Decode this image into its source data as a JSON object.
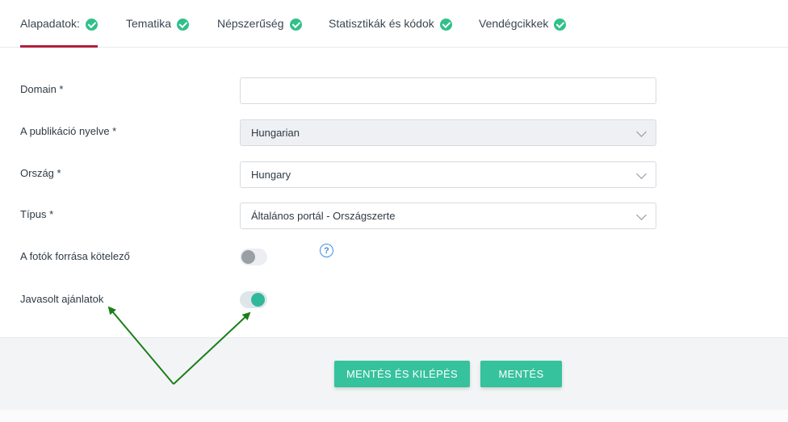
{
  "tabs": [
    {
      "label": "Alapadatok:",
      "active": true,
      "completed": true
    },
    {
      "label": "Tematika",
      "active": false,
      "completed": true
    },
    {
      "label": "Népszerűség",
      "active": false,
      "completed": true
    },
    {
      "label": "Statisztikák és kódok",
      "active": false,
      "completed": true
    },
    {
      "label": "Vendégcikkek",
      "active": false,
      "completed": true
    }
  ],
  "form": {
    "domain": {
      "label": "Domain *",
      "value": ""
    },
    "language": {
      "label": "A publikáció nyelve *",
      "value": "Hungarian",
      "disabled": true
    },
    "country": {
      "label": "Ország *",
      "value": "Hungary"
    },
    "type": {
      "label": "Típus *",
      "value": "Általános portál - Országszerte"
    },
    "photo_source": {
      "label": "A fotók forrása kötelező",
      "on": false
    },
    "recommended": {
      "label": "Javasolt ajánlatok",
      "on": true,
      "help": "?"
    }
  },
  "buttons": {
    "save_exit": "MENTÉS ÉS KILÉPÉS",
    "save": "MENTÉS"
  },
  "colors": {
    "accent": "#35c29c",
    "active_tab_underline": "#b21e3c",
    "annotation_arrow": "#1a7f1a",
    "help_icon": "#3d8fe0"
  }
}
